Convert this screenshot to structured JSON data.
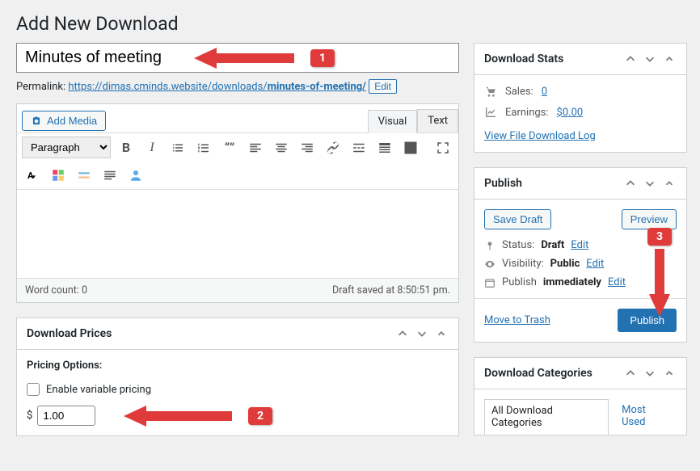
{
  "page_title": "Add New Download",
  "title_value": "Minutes of meeting",
  "permalink": {
    "label": "Permalink:",
    "url_display": "https://dimas.cminds.website/downloads/",
    "slug": "minutes-of-meeting/",
    "edit": "Edit"
  },
  "add_media": "Add Media",
  "editor_tabs": {
    "visual": "Visual",
    "text": "Text"
  },
  "format_select": "Paragraph",
  "word_count_label": "Word count: 0",
  "draft_saved": "Draft saved at 8:50:51 pm.",
  "download_prices": {
    "title": "Download Prices",
    "options_label": "Pricing Options:",
    "variable_label": "Enable variable pricing",
    "currency": "$",
    "price_value": "1.00"
  },
  "download_stats": {
    "title": "Download Stats",
    "sales_label": "Sales:",
    "sales_value": "0",
    "earnings_label": "Earnings:",
    "earnings_value": "$0.00",
    "log_link": "View File Download Log"
  },
  "publish_box": {
    "title": "Publish",
    "save_draft": "Save Draft",
    "preview": "Preview",
    "status_label": "Status:",
    "status_value": "Draft",
    "edit": "Edit",
    "visibility_label": "Visibility:",
    "visibility_value": "Public",
    "publish_label": "Publish",
    "publish_value": "immediately",
    "trash": "Move to Trash",
    "publish_btn": "Publish"
  },
  "download_categories": {
    "title": "Download Categories",
    "all": "All Download Categories",
    "most": "Most Used"
  },
  "annotations": {
    "n1": "1",
    "n2": "2",
    "n3": "3"
  }
}
